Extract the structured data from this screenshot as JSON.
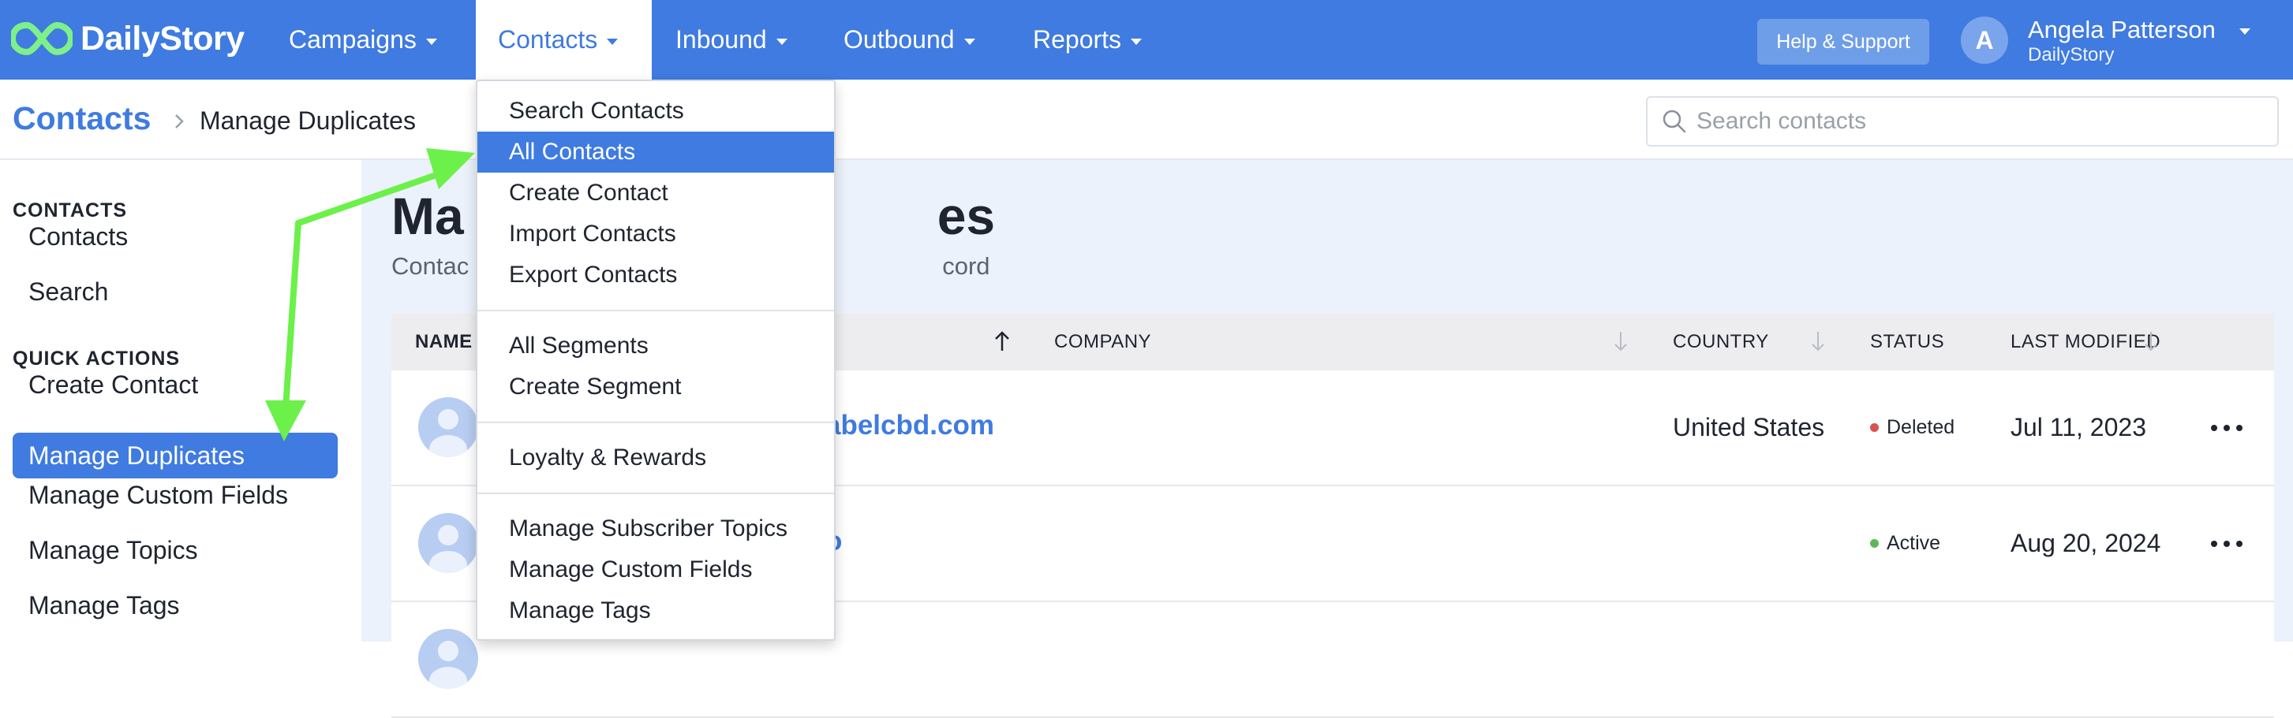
{
  "brand": {
    "name": "DailyStory"
  },
  "nav": {
    "items": [
      {
        "label": "Campaigns"
      },
      {
        "label": "Contacts"
      },
      {
        "label": "Inbound"
      },
      {
        "label": "Outbound"
      },
      {
        "label": "Reports"
      }
    ],
    "help_label": "Help & Support",
    "user": {
      "initial": "A",
      "name": "Angela Patterson",
      "org": "DailyStory"
    }
  },
  "breadcrumb": {
    "root": "Contacts",
    "current": "Manage Duplicates"
  },
  "search": {
    "placeholder": "Search contacts"
  },
  "sidebar": {
    "section1_heading": "CONTACTS",
    "section1_items": [
      {
        "label": "Contacts"
      },
      {
        "label": "Search"
      }
    ],
    "section2_heading": "QUICK ACTIONS",
    "section2_items": [
      {
        "label": "Create Contact"
      },
      {
        "label": "Manage Duplicates"
      },
      {
        "label": "Manage Custom Fields"
      },
      {
        "label": "Manage Topics"
      },
      {
        "label": "Manage Tags"
      }
    ]
  },
  "main": {
    "title_left": "Ma",
    "title_right": "es",
    "subtitle_left": "Contac",
    "subtitle_right": "cord"
  },
  "table": {
    "columns": {
      "name": "NAME",
      "company": "COMPANY",
      "country": "COUNTRY",
      "status": "STATUS",
      "modified": "LAST MODIFIED"
    },
    "rows": [
      {
        "email_fragment": "abelcbd.com",
        "country": "United States",
        "status": "Deleted",
        "modified": "Jul 11, 2023"
      },
      {
        "email_fragment": "o",
        "country": "",
        "status": "Active",
        "modified": "Aug 20, 2024"
      }
    ]
  },
  "dropdown": {
    "group1": [
      {
        "label": "Search Contacts"
      },
      {
        "label": "All Contacts"
      },
      {
        "label": "Create Contact"
      },
      {
        "label": "Import Contacts"
      },
      {
        "label": "Export Contacts"
      }
    ],
    "group2": [
      {
        "label": "All Segments"
      },
      {
        "label": "Create Segment"
      }
    ],
    "group3": [
      {
        "label": "Loyalty & Rewards"
      }
    ],
    "group4": [
      {
        "label": "Manage Subscriber Topics"
      },
      {
        "label": "Manage Custom Fields"
      },
      {
        "label": "Manage Tags"
      }
    ]
  },
  "colors": {
    "primary": "#3f7be0",
    "status_deleted": "#d9534f",
    "status_active": "#5cb85c",
    "annotation_arrow": "#6cf04a"
  }
}
